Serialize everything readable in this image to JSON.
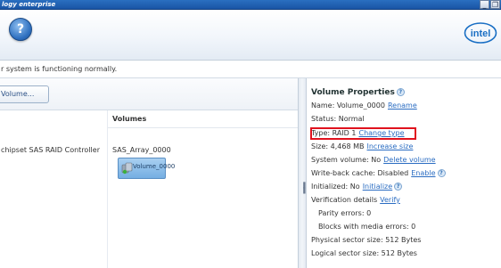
{
  "window": {
    "title": "logy enterprise",
    "buttons": {
      "minimize": "_",
      "restore": "❐"
    }
  },
  "header": {
    "help_symbol": "?",
    "brand_logo_text": "intel"
  },
  "status_bar": {
    "text": "r system is functioning normally."
  },
  "toolbar": {
    "create_volume_label": "Volume..."
  },
  "volumes_panel": {
    "header": "Volumes",
    "controller_label": "chipset SAS RAID Controller",
    "array_label": "SAS_Array_0000",
    "volume_label": "Volume_0000"
  },
  "properties": {
    "title": "Volume Properties",
    "name_label": "Name: Volume_0000",
    "rename_link": "Rename",
    "status": "Status: Normal",
    "type_label": "Type: RAID 1",
    "change_type_link": "Change type",
    "size_label": "Size: 4,468 MB",
    "increase_size_link": "Increase size",
    "system_volume_label": "System volume: No",
    "delete_volume_link": "Delete volume",
    "write_back_label": "Write-back cache: Disabled",
    "enable_link": "Enable",
    "initialized_label": "Initialized: No",
    "initialize_link": "Initialize",
    "verification_label": "Verification details",
    "verify_link": "Verify",
    "parity_errors": "Parity errors: 0",
    "media_errors": "Blocks with media errors: 0",
    "physical_sector": "Physical sector size: 512 Bytes",
    "logical_sector": "Logical sector size: 512 Bytes"
  },
  "colors": {
    "titlebar": "#1a55a5",
    "link": "#2a6cc2",
    "highlight_border": "#e0121e",
    "volume_tile": "#74aee2"
  }
}
